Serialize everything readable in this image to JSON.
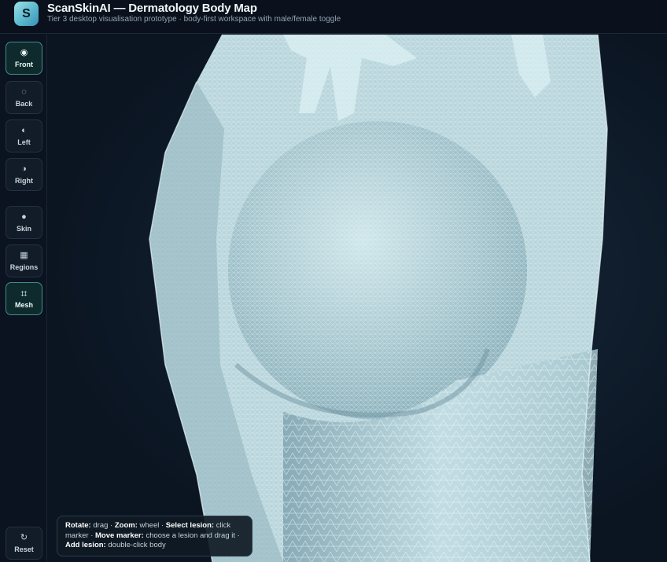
{
  "header": {
    "logo_letter": "S",
    "title": "ScanSkinAI — Dermatology Body Map",
    "subtitle": "Tier 3 desktop visualisation prototype · body-first workspace with male/female toggle"
  },
  "sidebar": {
    "views": [
      {
        "label": "Front",
        "icon": "◉",
        "active": true
      },
      {
        "label": "Back",
        "icon": "◌",
        "active": false
      },
      {
        "label": "Left",
        "icon": "◐",
        "active": false
      },
      {
        "label": "Right",
        "icon": "◑",
        "active": false
      }
    ],
    "layers": [
      {
        "label": "Skin",
        "icon": "●",
        "active": false
      },
      {
        "label": "Regions",
        "icon": "▦",
        "active": false
      },
      {
        "label": "Mesh",
        "icon": "⌗",
        "active": true
      }
    ],
    "reset": {
      "label": "Reset",
      "icon": "↻"
    }
  },
  "help": {
    "rotate_key": "Rotate:",
    "rotate_val": "drag",
    "zoom_key": "Zoom:",
    "zoom_val": "wheel",
    "select_key": "Select lesion:",
    "select_val": "click marker",
    "move_key": "Move marker:",
    "move_val": "choose a lesion and drag it",
    "add_key": "Add lesion:",
    "add_val": "double-click body",
    "sep": "·"
  },
  "colors": {
    "accent": "#3f8f8a",
    "mesh": "#dff3f5",
    "background": "#0b1220"
  }
}
